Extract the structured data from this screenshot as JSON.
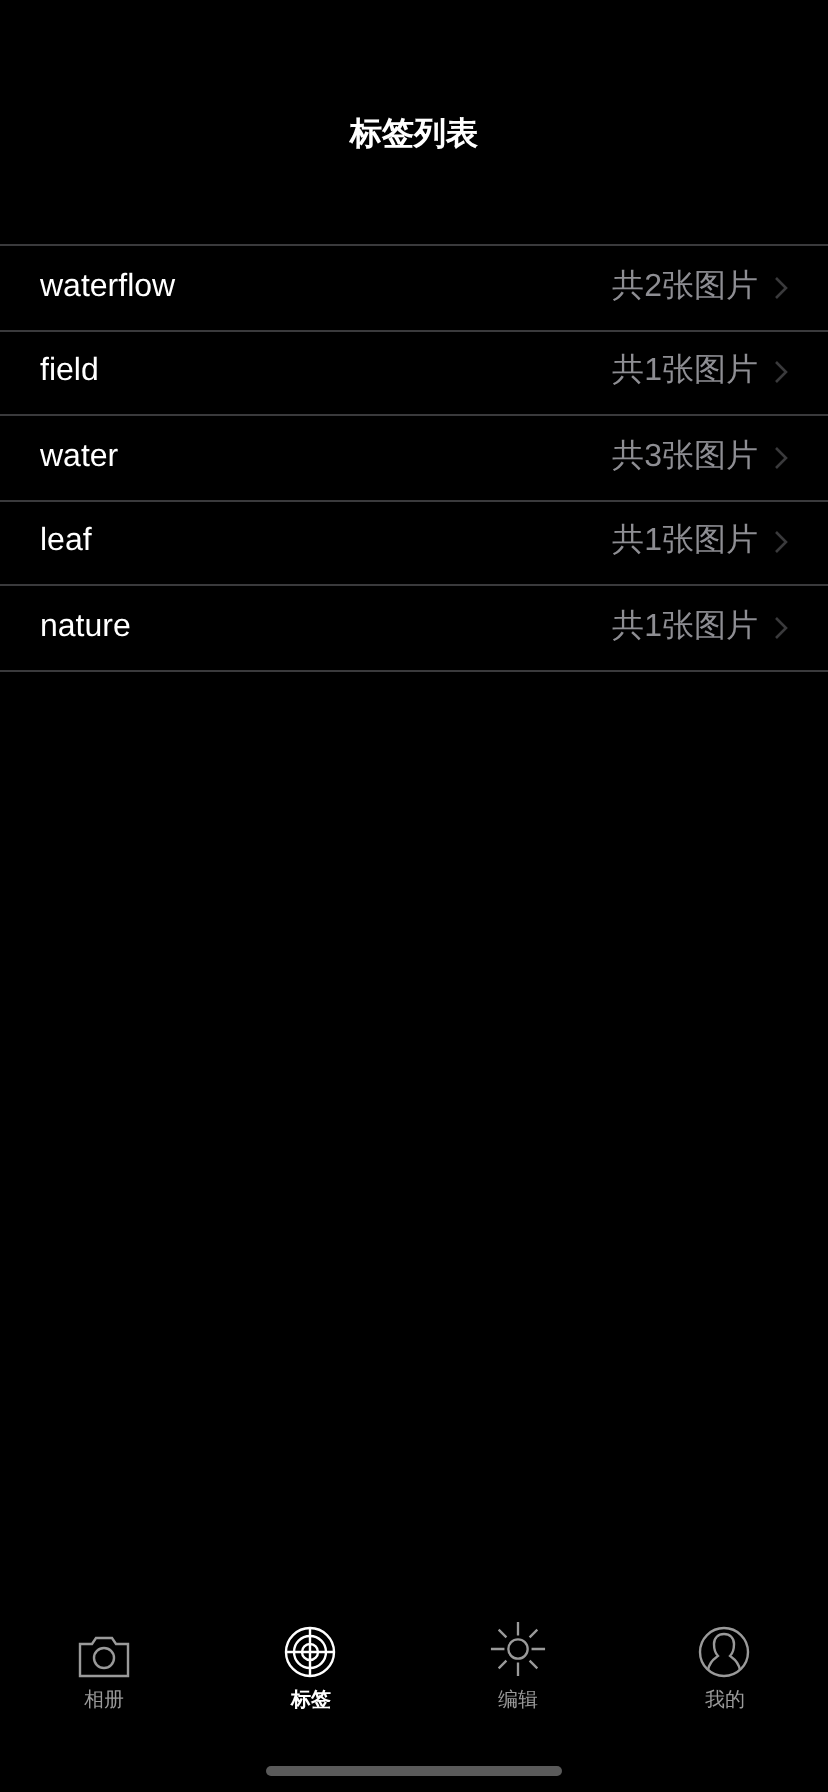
{
  "nav_bar": {
    "title": "标签列表"
  },
  "tags": [
    {
      "name": "waterflow",
      "count": "共2张图片"
    },
    {
      "name": "field",
      "count": "共1张图片"
    },
    {
      "name": "water",
      "count": "共3张图片"
    },
    {
      "name": "leaf",
      "count": "共1张图片"
    },
    {
      "name": "nature",
      "count": "共1张图片"
    }
  ],
  "tab_bar": [
    {
      "kind": "camera",
      "label": "相册",
      "selected": false
    },
    {
      "kind": "target",
      "label": "标签",
      "selected": true
    },
    {
      "kind": "sun",
      "label": "编辑",
      "selected": false
    },
    {
      "kind": "person",
      "label": "我的",
      "selected": false
    }
  ]
}
